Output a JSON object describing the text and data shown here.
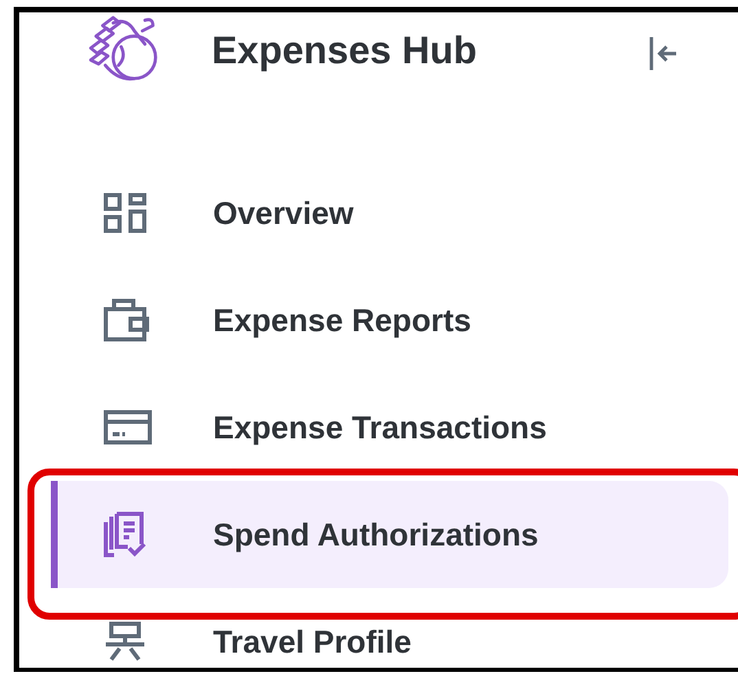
{
  "header": {
    "title": "Expenses Hub"
  },
  "nav": {
    "items": [
      {
        "label": "Overview",
        "selected": false
      },
      {
        "label": "Expense Reports",
        "selected": false
      },
      {
        "label": "Expense Transactions",
        "selected": false
      },
      {
        "label": "Spend Authorizations",
        "selected": true
      },
      {
        "label": "Travel Profile",
        "selected": false
      }
    ]
  }
}
